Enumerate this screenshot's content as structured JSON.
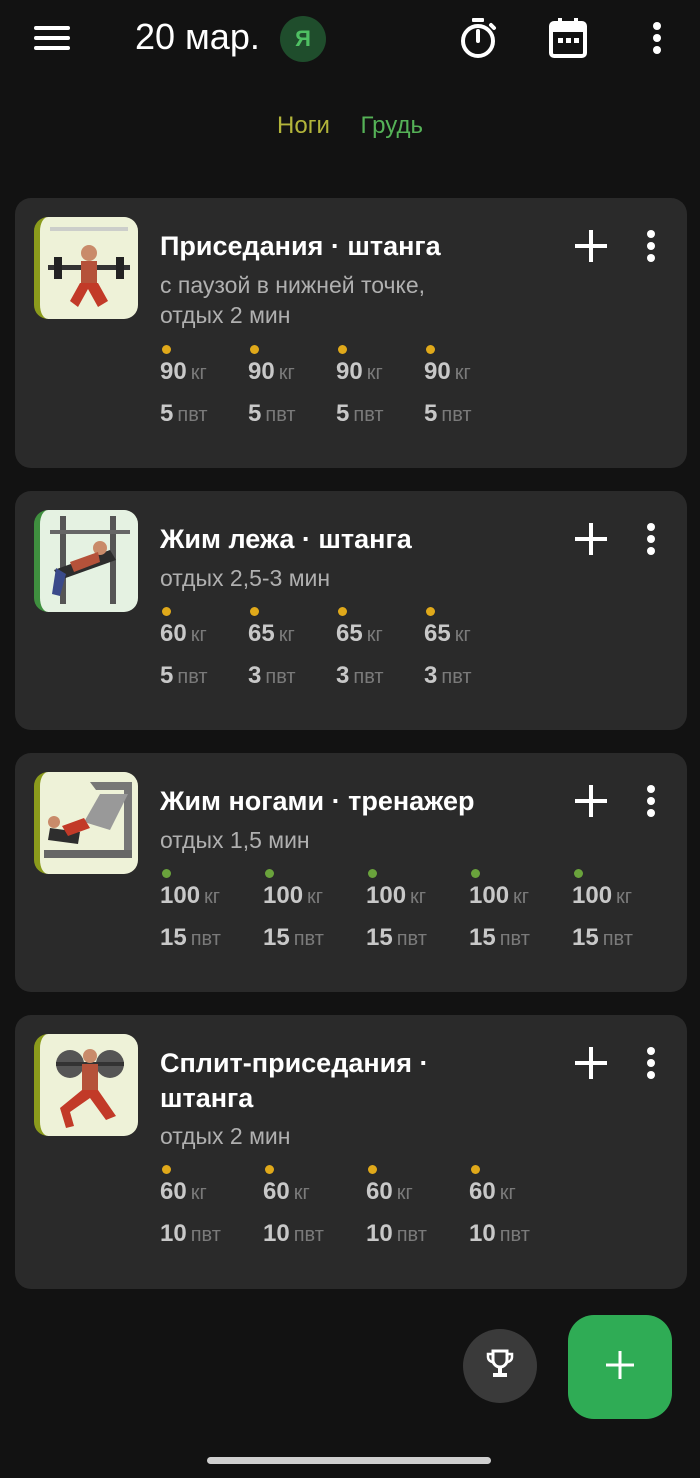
{
  "header": {
    "date": "20 мар.",
    "avatar_letter": "Я",
    "icons": [
      "menu-icon",
      "timer-icon",
      "calendar-icon",
      "more-vert-icon"
    ]
  },
  "muscle_groups": [
    "Ноги",
    "Грудь"
  ],
  "colors": {
    "background": "#121212",
    "card": "#2a2a2a",
    "legs": "#b2b43a",
    "chest": "#55b257",
    "dot_yellow": "#e0a91a",
    "dot_green": "#6aa33c",
    "fab": "#2fac55"
  },
  "exercises": [
    {
      "title": "Приседания · штанга",
      "notes": [
        "с паузой в нижней точке,",
        "отдых 2 мин"
      ],
      "sets": [
        {
          "weight": "90",
          "reps": "5"
        },
        {
          "weight": "90",
          "reps": "5"
        },
        {
          "weight": "90",
          "reps": "5"
        },
        {
          "weight": "90",
          "reps": "5"
        }
      ]
    },
    {
      "title": "Жим лежа · штанга",
      "notes": [
        "отдых 2,5-3 мин"
      ],
      "sets": [
        {
          "weight": "60",
          "reps": "5"
        },
        {
          "weight": "65",
          "reps": "3"
        },
        {
          "weight": "65",
          "reps": "3"
        },
        {
          "weight": "65",
          "reps": "3"
        }
      ]
    },
    {
      "title": "Жим ногами · тренажер",
      "notes": [
        "отдых 1,5 мин"
      ],
      "sets": [
        {
          "weight": "100",
          "reps": "15"
        },
        {
          "weight": "100",
          "reps": "15"
        },
        {
          "weight": "100",
          "reps": "15"
        },
        {
          "weight": "100",
          "reps": "15"
        },
        {
          "weight": "100",
          "reps": "15"
        }
      ]
    },
    {
      "title_lines": [
        "Сплит-приседания ·",
        "штанга"
      ],
      "notes": [
        "отдых 2 мин"
      ],
      "sets": [
        {
          "weight": "60",
          "reps": "10"
        },
        {
          "weight": "60",
          "reps": "10"
        },
        {
          "weight": "60",
          "reps": "10"
        },
        {
          "weight": "60",
          "reps": "10"
        }
      ]
    }
  ],
  "units": {
    "weight": "кг",
    "reps": "пвт"
  },
  "bottom": {
    "icons": [
      "trophy-icon",
      "add-icon"
    ]
  }
}
